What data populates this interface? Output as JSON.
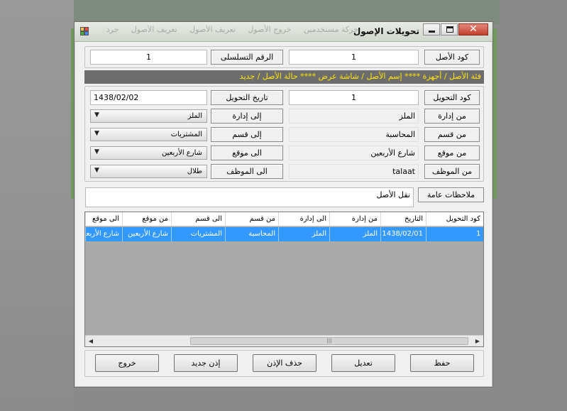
{
  "window": {
    "title": "تحويلات الإصول",
    "background_menu": [
      "حركة مستخدمين",
      "خروج الأصول",
      "تعريف الأصول",
      "تعريف الأصول",
      "جرد الأصول"
    ]
  },
  "asset": {
    "code_label": "كود الأصل",
    "code_value": "1",
    "serial_label": "الرقم التسلسلى",
    "serial_value": "1"
  },
  "banner": {
    "text": "فئة الأصل / أجهزة  ****  إسم الأصل / شاشة عرض  ****  حالة الأصل / جديد"
  },
  "transfer": {
    "code_label": "كود التحويل",
    "code_value": "1",
    "date_label": "تاريخ التحويل",
    "date_value": "1438/02/02",
    "from_dept_label": "من إدارة",
    "from_dept_value": "الملز",
    "to_dept_label": "إلى إدارة",
    "to_dept_value": "الملز",
    "from_section_label": "من قسم",
    "from_section_value": "المحاسبة",
    "to_section_label": "إلى قسم",
    "to_section_value": "المشتريات",
    "from_location_label": "من موقع",
    "from_location_value": "شارع الأربعين",
    "to_location_label": "الى موقع",
    "to_location_value": "شارع الأربعين",
    "from_employee_label": "من الموظف",
    "from_employee_value": "talaat",
    "to_employee_label": "الى الموظف",
    "to_employee_value": "طلال",
    "notes_label": "ملاحظات عامة",
    "notes_value": "نقل الأصل"
  },
  "grid": {
    "headers": [
      "كود التحويل",
      "التاريخ",
      "من إدارة",
      "الى إدارة",
      "من قسم",
      "الى قسم",
      "من موقع",
      "الى موقع"
    ],
    "rows": [
      [
        "1",
        "1438/02/01",
        "الملز",
        "الملز",
        "المحاسبة",
        "المشتريات",
        "شارع الأربعين",
        "شارع الأربعين"
      ]
    ],
    "scroll_thumb_glyph": "|||"
  },
  "buttons": {
    "save": "حفظ",
    "edit": "تعديل",
    "delete": "حذف الإذن",
    "new": "إذن جديد",
    "exit": "خروج"
  },
  "colors": {
    "banner_bg": "#6d6d6d",
    "banner_text": "#ffe600",
    "selection": "#3399ff"
  }
}
